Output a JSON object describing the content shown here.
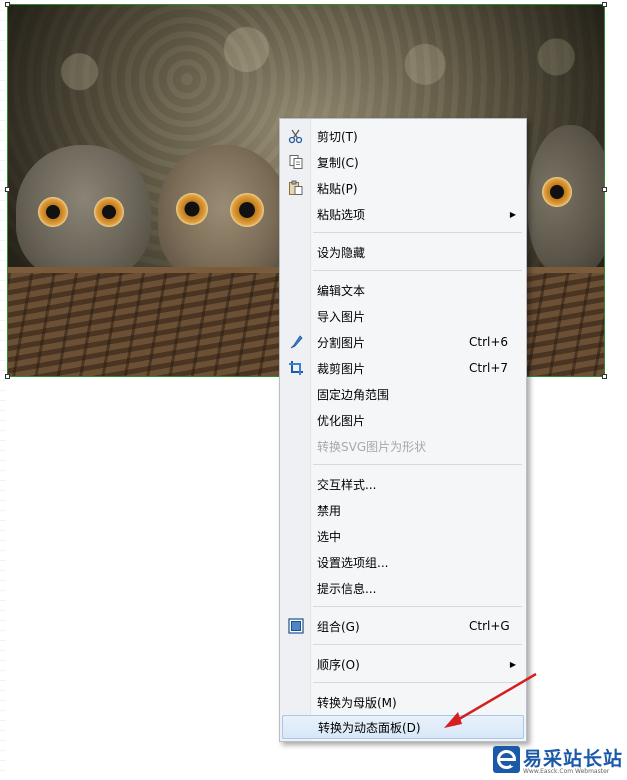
{
  "menu": {
    "items": [
      {
        "label": "剪切(T)",
        "icon": "scissors-icon"
      },
      {
        "label": "复制(C)",
        "icon": "copy-icon"
      },
      {
        "label": "粘贴(P)",
        "icon": "paste-icon"
      },
      {
        "label": "粘贴选项",
        "submenu": true
      },
      {
        "label": "设为隐藏"
      },
      {
        "label": "编辑文本"
      },
      {
        "label": "导入图片"
      },
      {
        "label": "分割图片",
        "shortcut": "Ctrl+6",
        "icon": "slice-icon"
      },
      {
        "label": "裁剪图片",
        "shortcut": "Ctrl+7",
        "icon": "crop-icon"
      },
      {
        "label": "固定边角范围"
      },
      {
        "label": "优化图片"
      },
      {
        "label": "转换SVG图片为形状",
        "disabled": true
      },
      {
        "label": "交互样式..."
      },
      {
        "label": "禁用"
      },
      {
        "label": "选中"
      },
      {
        "label": "设置选项组..."
      },
      {
        "label": "提示信息..."
      },
      {
        "label": "组合(G)",
        "shortcut": "Ctrl+G",
        "icon": "group-icon"
      },
      {
        "label": "顺序(O)",
        "submenu": true
      },
      {
        "label": "转换为母版(M)"
      },
      {
        "label": "转换为动态面板(D)",
        "highlighted": true
      }
    ],
    "submenu_arrow": "▶"
  },
  "watermark": {
    "logo_icon": "e-logo-icon",
    "text": "易采站长站",
    "url": "Www.Easck.Com Webmaster"
  },
  "colors": {
    "annotation_arrow": "#d42020",
    "selection_border": "#2e8b2e",
    "menu_highlight": "#d8e8f8"
  }
}
